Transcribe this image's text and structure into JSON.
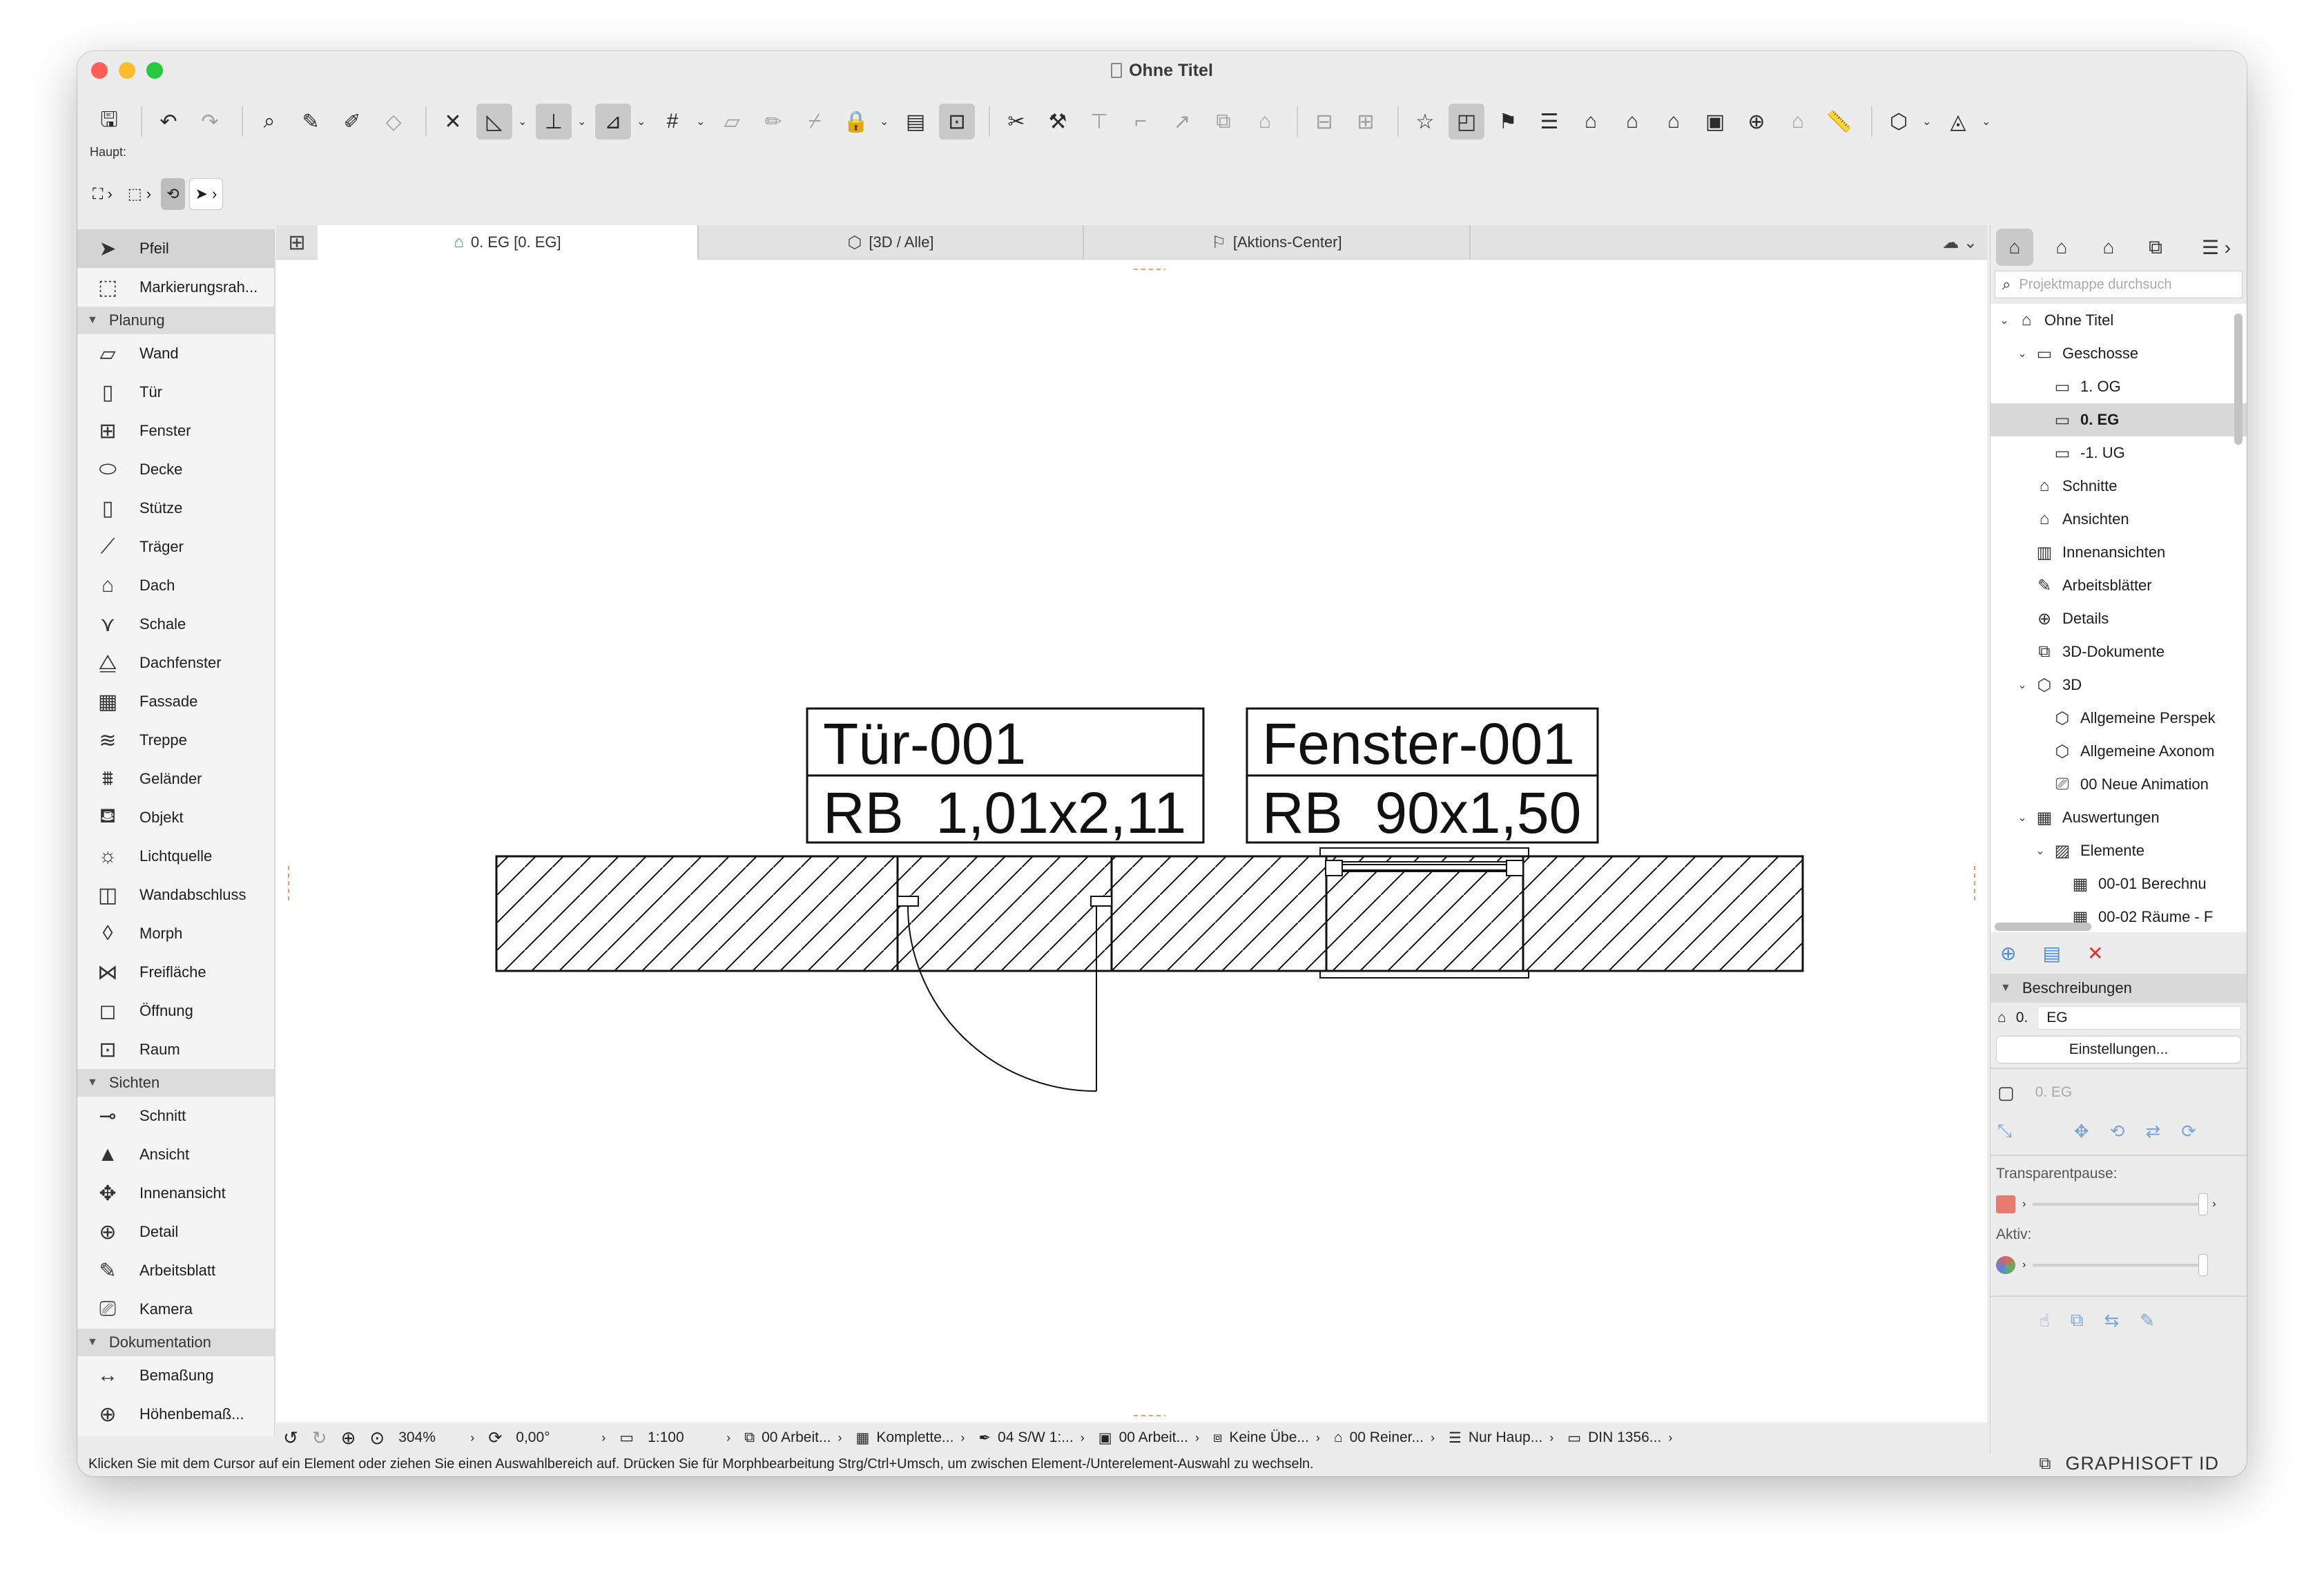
{
  "window": {
    "title": "Ohne Titel"
  },
  "toolbar": {
    "label": "Haupt:"
  },
  "palette": {
    "tools_top": [
      {
        "label": "Pfeil",
        "icon": "arrow-pointer-icon",
        "selected": true
      },
      {
        "label": "Markierungsrah...",
        "icon": "marquee-icon"
      }
    ],
    "sections": [
      {
        "title": "Planung",
        "items": [
          {
            "label": "Wand",
            "icon": "wall-icon"
          },
          {
            "label": "Tür",
            "icon": "door-icon"
          },
          {
            "label": "Fenster",
            "icon": "window-icon"
          },
          {
            "label": "Decke",
            "icon": "slab-icon"
          },
          {
            "label": "Stütze",
            "icon": "column-icon"
          },
          {
            "label": "Träger",
            "icon": "beam-icon"
          },
          {
            "label": "Dach",
            "icon": "roof-icon"
          },
          {
            "label": "Schale",
            "icon": "shell-icon"
          },
          {
            "label": "Dachfenster",
            "icon": "skylight-icon"
          },
          {
            "label": "Fassade",
            "icon": "curtain-wall-icon"
          },
          {
            "label": "Treppe",
            "icon": "stair-icon"
          },
          {
            "label": "Geländer",
            "icon": "railing-icon"
          },
          {
            "label": "Objekt",
            "icon": "object-icon"
          },
          {
            "label": "Lichtquelle",
            "icon": "lamp-icon"
          },
          {
            "label": "Wandabschluss",
            "icon": "wall-end-icon"
          },
          {
            "label": "Morph",
            "icon": "morph-icon"
          },
          {
            "label": "Freifläche",
            "icon": "mesh-icon"
          },
          {
            "label": "Öffnung",
            "icon": "opening-icon"
          },
          {
            "label": "Raum",
            "icon": "zone-icon"
          }
        ]
      },
      {
        "title": "Sichten",
        "items": [
          {
            "label": "Schnitt",
            "icon": "section-icon"
          },
          {
            "label": "Ansicht",
            "icon": "elevation-icon"
          },
          {
            "label": "Innenansicht",
            "icon": "interior-elevation-icon"
          },
          {
            "label": "Detail",
            "icon": "detail-icon"
          },
          {
            "label": "Arbeitsblatt",
            "icon": "worksheet-icon"
          },
          {
            "label": "Kamera",
            "icon": "camera-icon"
          }
        ]
      },
      {
        "title": "Dokumentation",
        "items": [
          {
            "label": "Bemaßung",
            "icon": "dimension-icon"
          },
          {
            "label": "Höhenbemaß...",
            "icon": "level-dimension-icon"
          }
        ]
      }
    ]
  },
  "tabs": [
    {
      "label": "0. EG [0. EG]",
      "icon": "floor-plan-icon",
      "active": true
    },
    {
      "label": "[3D / Alle]",
      "icon": "3d-window-icon",
      "active": false
    },
    {
      "label": "[Aktions-Center]",
      "icon": "action-center-icon",
      "active": false
    }
  ],
  "drawing": {
    "door_label": {
      "name": "Tür-001",
      "size": "RB  1,01x2,11"
    },
    "window_label": {
      "name": "Fenster-001",
      "size": "RB  90x1,50"
    }
  },
  "statusbar": {
    "zoom": "304%",
    "angle": "0,00°",
    "scale": "1:100",
    "layer": "00 Arbeit...",
    "model": "Komplette...",
    "pen": "04 S/W 1:...",
    "view": "00 Arbeit...",
    "override": "Keine Übe...",
    "renovation": "00 Reiner...",
    "structure": "Nur Haup...",
    "dimension": "DIN 1356..."
  },
  "hint": "Klicken Sie mit dem Cursor auf ein Element oder ziehen Sie einen Auswahlbereich auf. Drücken Sie für Morphbearbeitung Strg/Ctrl+Umsch, um zwischen Element-/Unterelement-Auswahl zu wechseln.",
  "brand": "GRAPHISOFT ID",
  "navigator": {
    "search_placeholder": "Projektmappe durchsuch",
    "tree": [
      {
        "label": "Ohne Titel",
        "level": 0,
        "twisty": "⌄",
        "icon": "house-icon"
      },
      {
        "label": "Geschosse",
        "level": 1,
        "twisty": "⌄",
        "icon": "stories-icon"
      },
      {
        "label": "1. OG",
        "level": 2,
        "twisty": "",
        "icon": "story-icon"
      },
      {
        "label": "0. EG",
        "level": 2,
        "twisty": "",
        "icon": "story-icon",
        "selected": true
      },
      {
        "label": "-1. UG",
        "level": 2,
        "twisty": "",
        "icon": "story-icon"
      },
      {
        "label": "Schnitte",
        "level": 1,
        "twisty": "",
        "icon": "sections-icon"
      },
      {
        "label": "Ansichten",
        "level": 1,
        "twisty": "",
        "icon": "elevations-icon"
      },
      {
        "label": "Innenansichten",
        "level": 1,
        "twisty": "",
        "icon": "interior-elevations-icon"
      },
      {
        "label": "Arbeitsblätter",
        "level": 1,
        "twisty": "",
        "icon": "worksheets-icon"
      },
      {
        "label": "Details",
        "level": 1,
        "twisty": "",
        "icon": "details-icon"
      },
      {
        "label": "3D-Dokumente",
        "level": 1,
        "twisty": "",
        "icon": "3d-documents-icon"
      },
      {
        "label": "3D",
        "level": 1,
        "twisty": "⌄",
        "icon": "3d-icon"
      },
      {
        "label": "Allgemeine Perspek",
        "level": 2,
        "twisty": "",
        "icon": "perspective-icon"
      },
      {
        "label": "Allgemeine Axonom",
        "level": 2,
        "twisty": "",
        "icon": "axonometry-icon"
      },
      {
        "label": "00 Neue Animation",
        "level": 2,
        "twisty": "",
        "icon": "animation-icon"
      },
      {
        "label": "Auswertungen",
        "level": 1,
        "twisty": "⌄",
        "icon": "schedules-icon"
      },
      {
        "label": "Elemente",
        "level": 2,
        "twisty": "⌄",
        "icon": "elements-icon"
      },
      {
        "label": "00-01 Berechnu",
        "level": 3,
        "twisty": "",
        "icon": "schedule-table-icon"
      },
      {
        "label": "00-02 Räume - F",
        "level": 3,
        "twisty": "",
        "icon": "schedule-table-icon"
      }
    ],
    "section_title": "Beschreibungen",
    "id_label": "0.",
    "id_value": "EG",
    "settings_button": "Einstellungen...",
    "view_field": "0. EG",
    "transparency_label": "Transparentpause:",
    "active_label": "Aktiv:"
  },
  "colors": {
    "accent": "#4a8ccf",
    "delete": "#e0302a",
    "close": "#ff5f57",
    "minimize": "#febc2e",
    "zoom": "#28c840"
  }
}
